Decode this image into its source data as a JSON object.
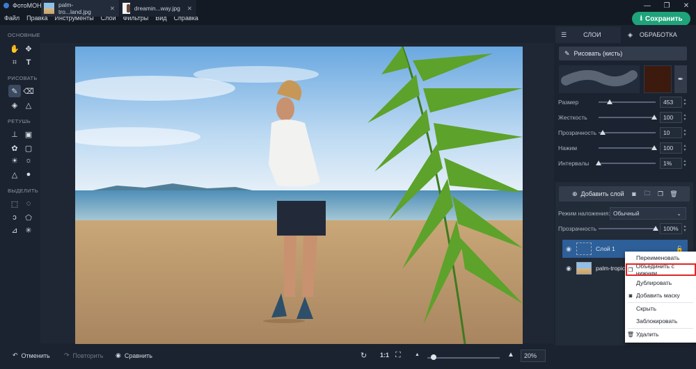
{
  "app": {
    "title": "ФотоМОНТАЖ"
  },
  "menu": [
    "Файл",
    "Правка",
    "Инструменты",
    "Слой",
    "Фильтры",
    "Вид",
    "Справка"
  ],
  "save_button": "Сохранить",
  "tools": {
    "sections": [
      "ОСНОВНЫЕ",
      "РИСОВАТЬ",
      "РЕТУШЬ",
      "ВЫДЕЛИТЬ"
    ]
  },
  "tabs": [
    {
      "label": "palm-tro...land.jpg",
      "close": "✕"
    },
    {
      "label": "dreamin...way.jpg",
      "close": "✕"
    }
  ],
  "bottom": {
    "undo": "Отменить",
    "redo": "Повторить",
    "compare": "Сравнить",
    "ratio": "1:1",
    "zoom_value": "20%",
    "zoom_fraction": 0.05
  },
  "right_panel": {
    "tab_layers": "СЛОИ",
    "tab_processing": "ОБРАБОТКА",
    "brush_title": "Рисовать (кисть)",
    "brush_color": "#3d1a0e",
    "sliders": [
      {
        "label": "Размер",
        "value": "453",
        "fraction": 0.2
      },
      {
        "label": "Жесткость",
        "value": "100",
        "fraction": 0.97
      },
      {
        "label": "Прозрачность",
        "value": "10",
        "fraction": 0.07
      },
      {
        "label": "Нажим",
        "value": "100",
        "fraction": 0.97
      },
      {
        "label": "Интервалы",
        "value": "1%",
        "fraction": 0.0
      }
    ],
    "add_layer": "Добавить слой",
    "blend_label": "Режим наложения:",
    "blend_value": "Обычный",
    "opacity_label": "Прозрачность",
    "opacity_value": "100%",
    "opacity_fraction": 1.0,
    "layers": [
      {
        "name": "Слой 1",
        "selected": true
      },
      {
        "name": "palm-tropic",
        "selected": false
      }
    ]
  },
  "context_menu": [
    {
      "label": "Переименовать",
      "icon": ""
    },
    {
      "label": "Объединить с нижним",
      "icon": "merge-icon",
      "highlighted": true
    },
    {
      "label": "Дублировать",
      "icon": ""
    },
    {
      "label": "Добавить маску",
      "icon": "mask-icon"
    },
    {
      "label": "Скрыть",
      "icon": ""
    },
    {
      "label": "Заблокировать",
      "icon": ""
    },
    {
      "label": "Удалить",
      "icon": "trash-icon"
    }
  ],
  "colors": {
    "accent_green": "#1fa37a",
    "selection_blue": "#2d5f99",
    "highlight_red": "#e02424"
  }
}
